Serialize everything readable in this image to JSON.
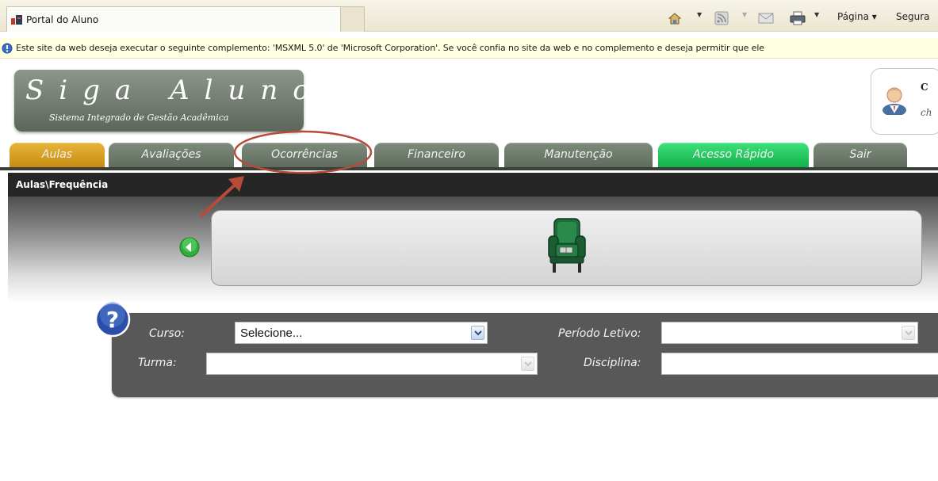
{
  "browser": {
    "tab_title": "Portal do Aluno",
    "commands": {
      "pagina": "Página ▾",
      "seguranca": "Segura"
    }
  },
  "infobar": {
    "text": "Este site da web deseja executar o seguinte complemento: 'MSXML 5.0' de 'Microsoft Corporation'. Se você confia no site da web e no complemento e deseja permitir que ele"
  },
  "logo": {
    "title": "Siga Aluno",
    "subtitle": "Sistema Integrado de Gestão Acadêmica"
  },
  "user": {
    "initial": "C",
    "line2": "ch"
  },
  "nav": {
    "tabs": [
      {
        "label": "Aulas",
        "color": "#d9a024",
        "active": true
      },
      {
        "label": "Avaliações",
        "color": "#6b786a"
      },
      {
        "label": "Ocorrências",
        "color": "#6b786a"
      },
      {
        "label": "Financeiro",
        "color": "#6b786a"
      },
      {
        "label": "Manutenção",
        "color": "#6b786a"
      },
      {
        "label": "Acesso Rápido",
        "color": "#1ec45c"
      },
      {
        "label": "Sair",
        "color": "#6b786a"
      }
    ]
  },
  "breadcrumb": "Aulas\\Frequência",
  "filters": {
    "curso_label": "Curso:",
    "curso_value": "Selecione...",
    "periodo_label": "Período Letivo:",
    "periodo_value": "",
    "turma_label": "Turma:",
    "turma_value": "",
    "disciplina_label": "Disciplina:",
    "disciplina_value": ""
  },
  "icons": {
    "back": "green-back-arrow-icon",
    "chair": "armchair-icon",
    "help": "help-question-icon",
    "avatar": "user-avatar-icon"
  },
  "annotation": {
    "color": "#b84a3a",
    "highlights": "Ocorrências"
  }
}
